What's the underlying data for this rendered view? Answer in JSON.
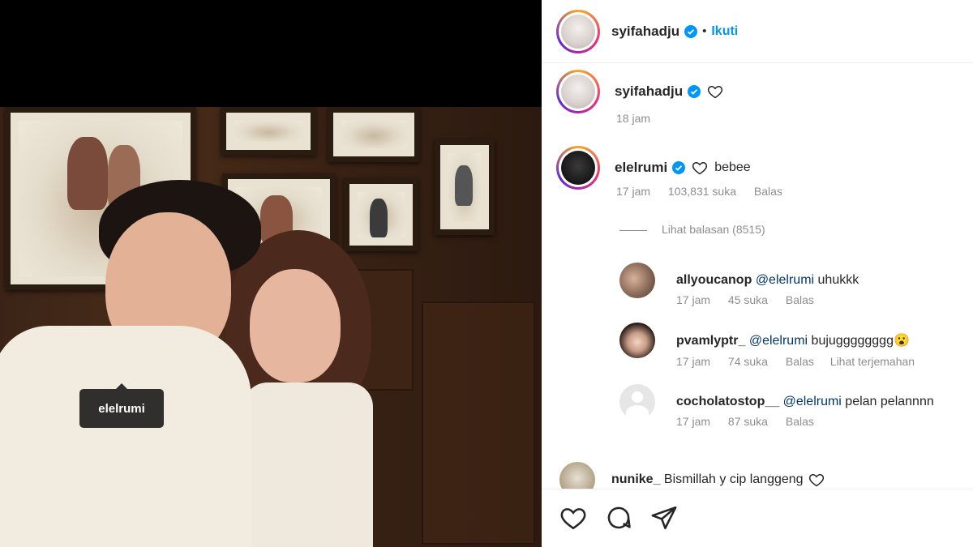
{
  "photo_tag": {
    "label": "elelrumi"
  },
  "post": {
    "author": "syifahadju",
    "follow_label": "Ikuti",
    "caption_author": "syifahadju",
    "caption_time": "18 jam"
  },
  "comments": [
    {
      "user": "elelrumi",
      "text": "bebee",
      "time": "17 jam",
      "likes": "103,831 suka",
      "reply": "Balas",
      "view_replies": "Lihat balasan (8515)"
    }
  ],
  "replies": [
    {
      "user": "allyoucanop",
      "mention": "@elelrumi",
      "text": " uhukkk",
      "time": "17 jam",
      "likes": "45 suka",
      "reply": "Balas"
    },
    {
      "user": "pvamlyptr_",
      "mention": "@elelrumi",
      "text": " bujugggggggg",
      "emoji": "😮",
      "time": "17 jam",
      "likes": "74 suka",
      "reply": "Balas",
      "translate": "Lihat terjemahan"
    },
    {
      "user": "cocholatostop__",
      "mention": "@elelrumi",
      "text": " pelan pelannnn",
      "time": "17 jam",
      "likes": "87 suka",
      "reply": "Balas"
    }
  ],
  "last_comment": {
    "user": "nunike_",
    "text": "Bismillah y cip langgeng"
  },
  "icons": [
    "heart-icon",
    "comment-icon",
    "share-icon",
    "verified-icon"
  ],
  "colors": {
    "accent": "#0095f6",
    "verified": "#0095f6",
    "text": "#262626",
    "muted": "#8e8e8e"
  }
}
